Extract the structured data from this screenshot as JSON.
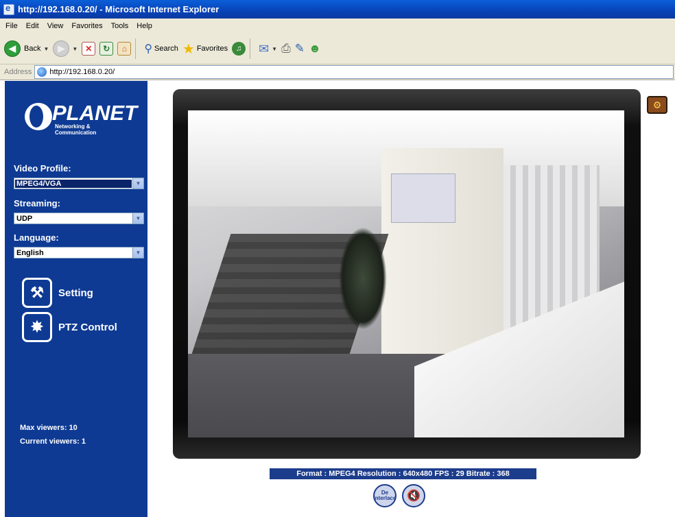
{
  "window": {
    "title": "http://192.168.0.20/ - Microsoft Internet Explorer"
  },
  "menu": [
    "File",
    "Edit",
    "View",
    "Favorites",
    "Tools",
    "Help"
  ],
  "toolbar": {
    "back_label": "Back",
    "search_label": "Search",
    "favorites_label": "Favorites"
  },
  "address": {
    "label": "Address",
    "url": "http://192.168.0.20/"
  },
  "logo": {
    "brand": "PLANET",
    "tagline": "Networking & Communication"
  },
  "sidebar": {
    "video_profile_label": "Video Profile:",
    "video_profile_value": "MPEG4/VGA",
    "streaming_label": "Streaming:",
    "streaming_value": "UDP",
    "language_label": "Language:",
    "language_value": "English",
    "setting_label": "Setting",
    "ptz_label": "PTZ Control",
    "max_viewers": "Max viewers: 10",
    "current_viewers": "Current viewers:  1"
  },
  "info_bar": "Format : MPEG4   Resolution : 640x480   FPS : 29   Bitrate : 368",
  "controls": {
    "deinterlace_label": "De Interlace"
  },
  "colors": {
    "sidebar_bg": "#0e3a93",
    "info_bg": "#1c3c8c",
    "title_bg": "#0842b8"
  },
  "icons": [
    "ie-icon",
    "back-icon",
    "forward-icon",
    "stop-icon",
    "refresh-icon",
    "home-icon",
    "search-icon",
    "favorites-icon",
    "media-icon",
    "mail-icon",
    "print-icon",
    "edit-icon",
    "messenger-icon",
    "page-icon",
    "settings-icon",
    "ptz-icon",
    "deinterlace-icon",
    "mute-icon",
    "toolbox-icon"
  ]
}
